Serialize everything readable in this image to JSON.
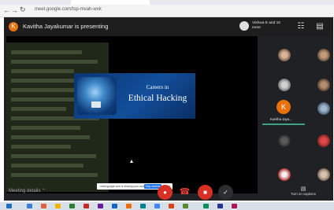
{
  "browser": {
    "nav_icons": [
      "back-arrow-icon",
      "forward-arrow-icon",
      "reload-icon"
    ],
    "url": "meet.google.com/tsp-mvah-wxk"
  },
  "header": {
    "presenter_initial": "K",
    "presenting_text": "Kavitha Jayakumar is presenting",
    "people_text": "Vishwa E and 10 more",
    "icons": [
      "people-icon",
      "chat-icon"
    ]
  },
  "slide": {
    "title_line1": "Careers in",
    "title_line2": "Ethical Hacking"
  },
  "notice": {
    "message": "meet.google.com is sharing your screen",
    "stop_label": "Stop sharing",
    "hide_label": "Hide"
  },
  "participants": {
    "presenter_initial": "K",
    "presenter_label": "Kavitha Jaya..."
  },
  "controls": {
    "meeting_details": "Meeting details",
    "captions_label": "Turn on captions",
    "icons": [
      "mic-off-icon",
      "end-call-icon",
      "camera-off-icon",
      "check-icon",
      "captions-icon"
    ]
  },
  "colors": {
    "meet_bg": "#202124",
    "accent_red": "#d93025",
    "presenter_orange": "#e8710a",
    "speaking_green": "#3ba37f"
  }
}
